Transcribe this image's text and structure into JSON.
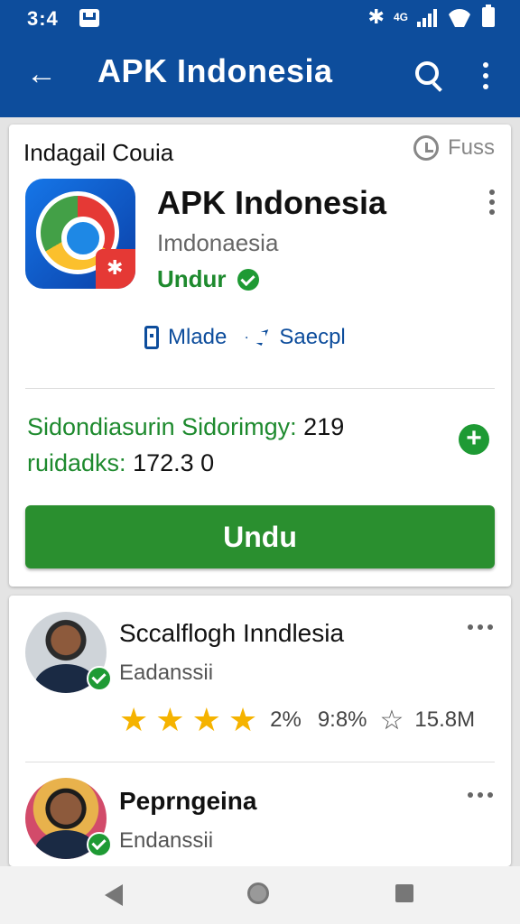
{
  "status_bar": {
    "time": "3:4",
    "signal_label": "4G"
  },
  "app_bar": {
    "title": "APK Indonesia"
  },
  "card": {
    "header": "Indagail Couia",
    "fuss_label": "Fuss",
    "app_name": "APK Indonesia",
    "developer": "Imdonaesia",
    "status": "Undur",
    "actions": [
      {
        "label": "Mlade",
        "icon": "phone-icon"
      },
      {
        "label": "Saecpl",
        "icon": "paper-plane-icon"
      }
    ],
    "stats_line1_label": "Sidondiasurin Sidorimgy:",
    "stats_line1_value": "219",
    "stats_line2_label": "ruidadks:",
    "stats_line2_value": "172.3 0",
    "install_label": "Undu"
  },
  "reviews": [
    {
      "name": "Sccalflogh Inndlesia",
      "role": "Eadanssii",
      "stars": 4,
      "pct1": "2%",
      "pct2": "9:8%",
      "count": "15.8M"
    },
    {
      "name": "Peprngeina",
      "role": "Endanssii"
    }
  ],
  "colors": {
    "app_bar": "#0d4d9c",
    "accent_green": "#2a8f2f",
    "star": "#f5b300"
  }
}
